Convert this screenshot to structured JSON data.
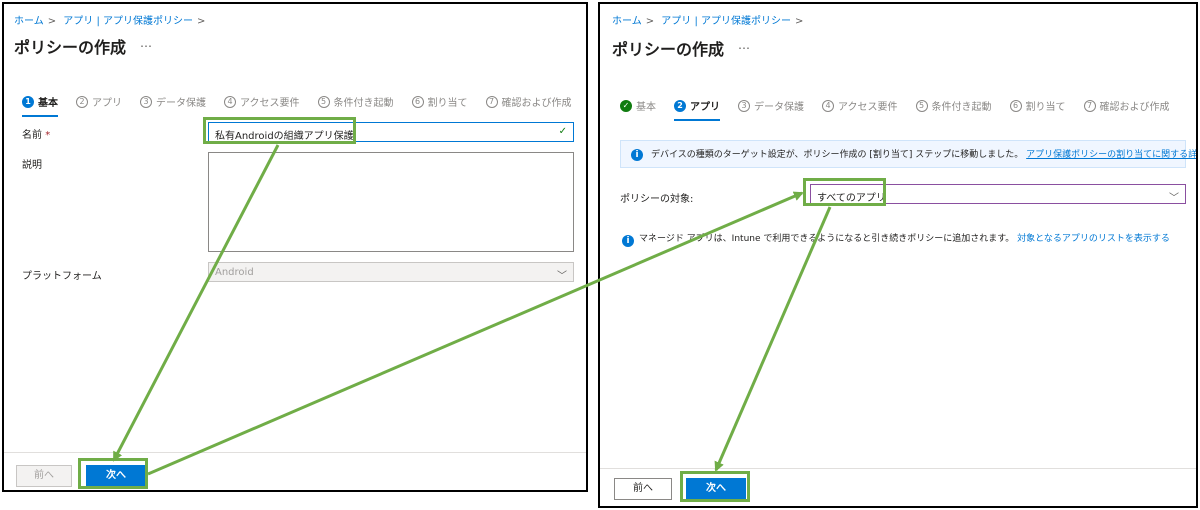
{
  "breadcrumb": [
    "ホーム",
    "アプリ | アプリ保護ポリシー"
  ],
  "title": "ポリシーの作成",
  "more": "…",
  "left": {
    "steps": [
      {
        "num": "1",
        "label": "基本"
      },
      {
        "num": "2",
        "label": "アプリ"
      },
      {
        "num": "3",
        "label": "データ保護"
      },
      {
        "num": "4",
        "label": "アクセス要件"
      },
      {
        "num": "5",
        "label": "条件付き起動"
      },
      {
        "num": "6",
        "label": "割り当て"
      },
      {
        "num": "7",
        "label": "確認および作成"
      }
    ],
    "name_label": "名前",
    "required_mark": "*",
    "name_value": "私有Androidの組織アプリ保護",
    "description_label": "説明",
    "platform_label": "プラットフォーム",
    "platform_value": "Android",
    "prev_button": "前へ",
    "next_button": "次へ"
  },
  "right": {
    "steps": [
      {
        "num": "✓",
        "label": "基本"
      },
      {
        "num": "2",
        "label": "アプリ"
      },
      {
        "num": "3",
        "label": "データ保護"
      },
      {
        "num": "4",
        "label": "アクセス要件"
      },
      {
        "num": "5",
        "label": "条件付き起動"
      },
      {
        "num": "6",
        "label": "割り当て"
      },
      {
        "num": "7",
        "label": "確認および作成"
      }
    ],
    "info_text": "デバイスの種類のターゲット設定が、ポリシー作成の [割り当て] ステップに移動しました。",
    "info_link": "アプリ保護ポリシーの割り当てに関する詳細情報",
    "target_label": "ポリシーの対象:",
    "target_value": "すべてのアプリ",
    "managed_note": "マネージド アプリは、Intune で利用できるようになると引き続きポリシーに追加されます。",
    "managed_link": "対象となるアプリのリストを表示する",
    "prev_button": "前へ",
    "next_button": "次へ"
  },
  "colors": {
    "accent": "#0078d4",
    "highlight": "#70ad47",
    "success": "#107c10"
  }
}
